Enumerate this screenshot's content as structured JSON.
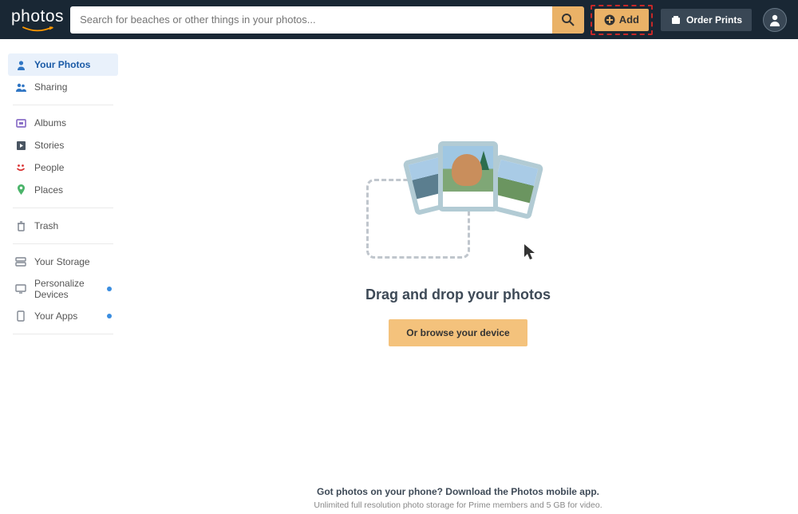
{
  "header": {
    "logo": "photos",
    "search_placeholder": "Search for beaches or other things in your photos...",
    "add_label": "Add",
    "order_prints_label": "Order Prints"
  },
  "sidebar": {
    "items": [
      {
        "label": "Your Photos",
        "icon": "person-icon",
        "active": true
      },
      {
        "label": "Sharing",
        "icon": "people-icon"
      },
      {
        "label": "Albums",
        "icon": "album-icon"
      },
      {
        "label": "Stories",
        "icon": "play-icon"
      },
      {
        "label": "People",
        "icon": "face-icon"
      },
      {
        "label": "Places",
        "icon": "pin-icon"
      },
      {
        "label": "Trash",
        "icon": "trash-icon"
      }
    ],
    "secondary": [
      {
        "label": "Your Storage",
        "icon": "storage-icon"
      },
      {
        "label": "Personalize Devices",
        "icon": "desktop-icon",
        "dot": true
      },
      {
        "label": "Your Apps",
        "icon": "phone-icon",
        "dot": true
      }
    ]
  },
  "main": {
    "title": "Drag and drop your photos",
    "browse_label": "Or browse your device"
  },
  "footer": {
    "title": "Got photos on your phone? Download the Photos mobile app.",
    "subtitle": "Unlimited full resolution photo storage for Prime members and 5 GB for video."
  },
  "colors": {
    "header_bg": "#192734",
    "accent": "#eab267",
    "highlight_border": "#c62828",
    "link": "#3a8de0"
  }
}
